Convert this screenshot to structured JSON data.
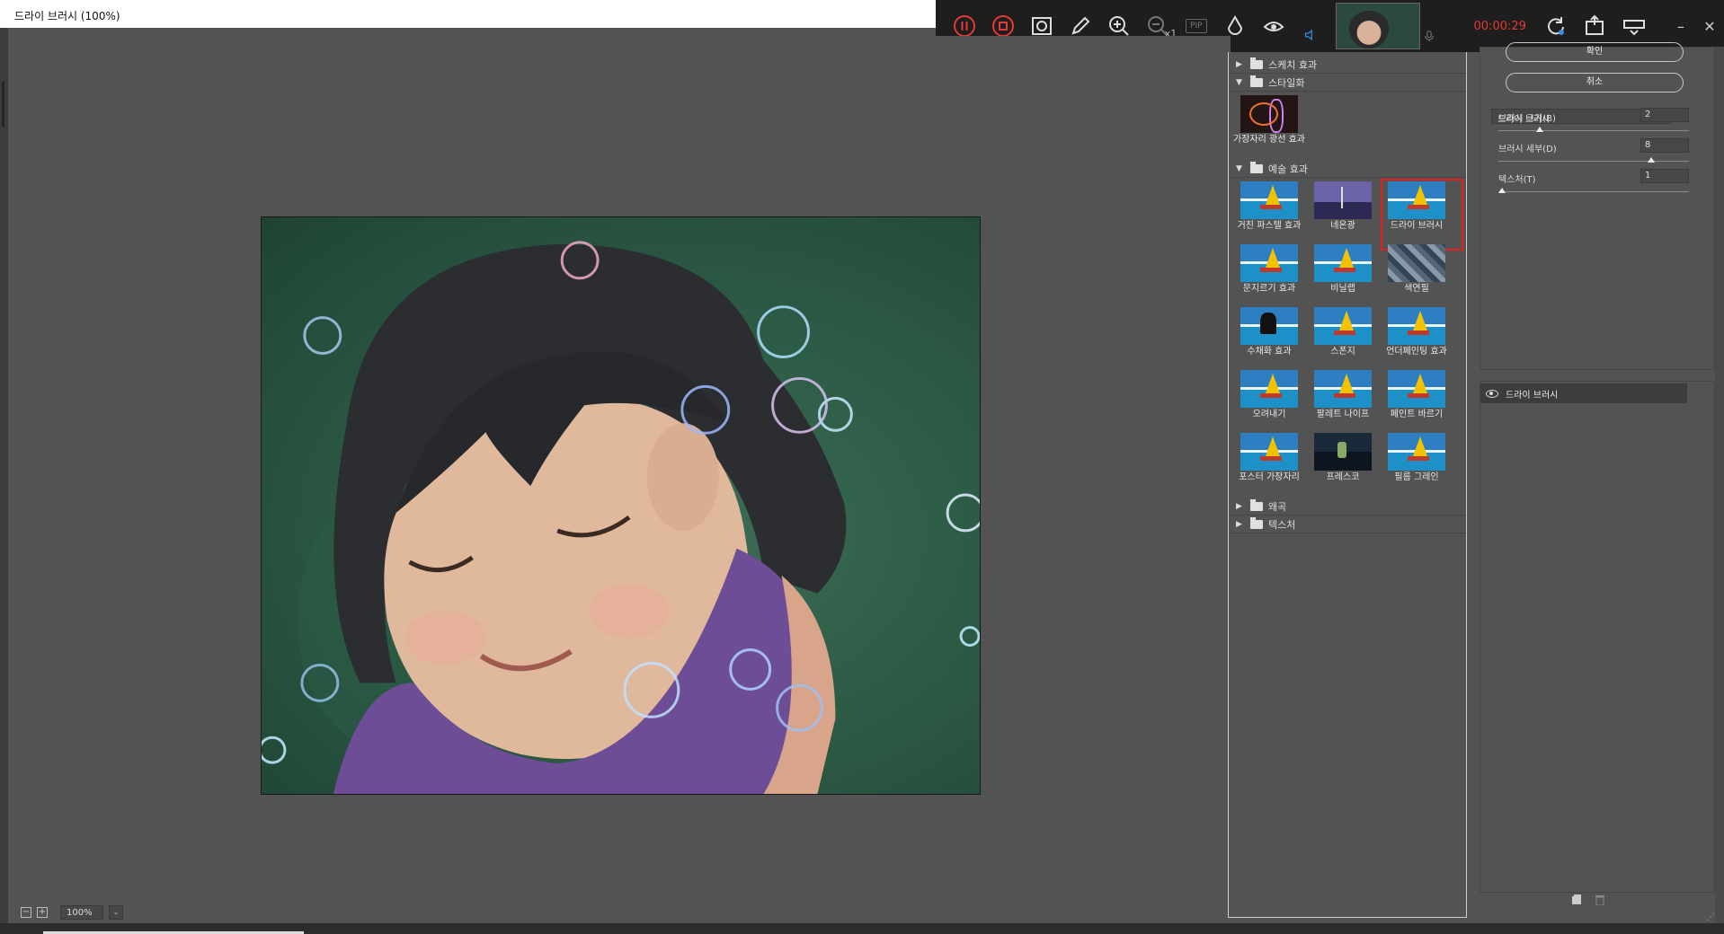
{
  "window": {
    "title": "드라이 브러시 (100%)"
  },
  "recorder": {
    "zoom_multiplier": "x1",
    "pip_label": "PIP",
    "timer": "00:00:29",
    "icons": [
      "pause-icon",
      "stop-icon",
      "screenshot-icon",
      "pencil-icon",
      "zoom-in-icon",
      "zoom-out-icon",
      "pip-icon",
      "cursor-effect-icon",
      "eye-effect-icon",
      "audio-icon",
      "webcam-thumbnail",
      "mic-icon",
      "refresh-icon",
      "export-icon",
      "keyboard-icon"
    ],
    "minimize": "–",
    "close": "✕"
  },
  "status": {
    "zoom": "100%",
    "zoom_dropdown": "⌄"
  },
  "gallery": {
    "categories": [
      {
        "label": "스케치 효과",
        "expanded": false
      },
      {
        "label": "스타일화",
        "expanded": true,
        "items": [
          {
            "label": "가장자리 광선 효과",
            "thumb": "glow"
          }
        ]
      },
      {
        "label": "예술 효과",
        "expanded": true,
        "items": [
          {
            "label": "거친 파스텔 효과",
            "thumb": "sea"
          },
          {
            "label": "네온광",
            "thumb": "neon"
          },
          {
            "label": "드라이 브러시",
            "thumb": "sea",
            "selected": true
          },
          {
            "label": "문지르기 효과",
            "thumb": "sea"
          },
          {
            "label": "비닐랩",
            "thumb": "sea"
          },
          {
            "label": "색연필",
            "thumb": "stained"
          },
          {
            "label": "수채화 효과",
            "thumb": "blackbird"
          },
          {
            "label": "스폰지",
            "thumb": "sea"
          },
          {
            "label": "언더페인팅 효과",
            "thumb": "sea"
          },
          {
            "label": "오려내기",
            "thumb": "sea"
          },
          {
            "label": "팔레트 나이프",
            "thumb": "sea"
          },
          {
            "label": "페인트 바르기",
            "thumb": "sea"
          },
          {
            "label": "포스터 가장자리",
            "thumb": "sea"
          },
          {
            "label": "프레스코",
            "thumb": "fresco"
          },
          {
            "label": "필름 그레인",
            "thumb": "sea"
          }
        ]
      },
      {
        "label": "왜곡",
        "expanded": false
      },
      {
        "label": "텍스처",
        "expanded": false
      }
    ]
  },
  "props": {
    "ok_label": "확인",
    "cancel_label": "취소",
    "filter_select": "드라이 브러시",
    "params": [
      {
        "label": "브러시 크기(B)",
        "value": "2",
        "level": 0.2
      },
      {
        "label": "브러시 세부(D)",
        "value": "8",
        "level": 0.8
      },
      {
        "label": "텍스처(T)",
        "value": "1",
        "level": 0.0
      }
    ]
  },
  "layers": {
    "active_layer": "드라이 브러시"
  },
  "colors": {
    "accent_red": "#e02020",
    "timer_red": "#e53935",
    "panel_bg": "#535353"
  }
}
